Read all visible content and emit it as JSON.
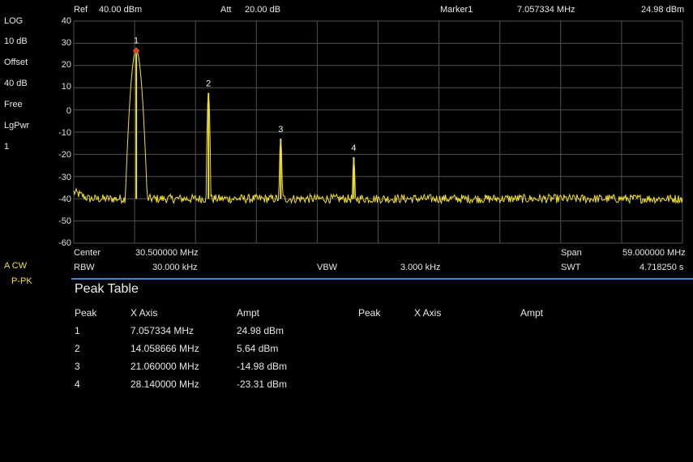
{
  "header": {
    "ref_label": "Ref",
    "ref_value": "40.00 dBm",
    "att_label": "Att",
    "att_value": "20.00 dB",
    "marker_label": "Marker1",
    "marker_freq": "7.057334 MHz",
    "marker_ampt": "24.98 dBm"
  },
  "sidebar": {
    "scale_mode": "LOG",
    "scale_div": "10 dB",
    "offset_label": "Offset",
    "offset_value": "40 dB",
    "trigger": "Free",
    "detector": "LgPwr",
    "avg_count": "1",
    "trace_mode": "A CW",
    "trace_detector": "P-PK"
  },
  "footer": {
    "center_label": "Center",
    "center_value": "30.500000 MHz",
    "span_label": "Span",
    "span_value": "59.000000 MHz",
    "rbw_label": "RBW",
    "rbw_value": "30.000 kHz",
    "vbw_label": "VBW",
    "vbw_value": "3.000 kHz",
    "swt_label": "SWT",
    "swt_value": "4.718250 s"
  },
  "peak_table": {
    "title": "Peak Table",
    "headers": [
      "Peak",
      "X Axis",
      "Ampt",
      "Peak",
      "X Axis",
      "Ampt"
    ],
    "rows": [
      {
        "peak": "1",
        "x": "7.057334 MHz",
        "ampt": "24.98 dBm"
      },
      {
        "peak": "2",
        "x": "14.058666 MHz",
        "ampt": "5.64 dBm"
      },
      {
        "peak": "3",
        "x": "21.060000 MHz",
        "ampt": "-14.98 dBm"
      },
      {
        "peak": "4",
        "x": "28.140000 MHz",
        "ampt": "-23.31 dBm"
      }
    ]
  },
  "colors": {
    "trace": "#f0e030",
    "marker": "#e04020",
    "grid": "#505050",
    "separator": "#3a86d0"
  },
  "chart_data": {
    "type": "line",
    "x_start_mhz": 1.0,
    "x_stop_mhz": 60.0,
    "ylim": [
      -60,
      40
    ],
    "yticks": [
      "40",
      "30",
      "20",
      "10",
      "0",
      "-10",
      "-20",
      "-30",
      "-40",
      "-50",
      "-60"
    ],
    "grid": true,
    "noise_floor_dbm": -40,
    "peaks": [
      {
        "label": "1",
        "freq_mhz": 7.057334,
        "ampt_dbm": 24.98
      },
      {
        "label": "2",
        "freq_mhz": 14.058666,
        "ampt_dbm": 5.64
      },
      {
        "label": "3",
        "freq_mhz": 21.06,
        "ampt_dbm": -14.98
      },
      {
        "label": "4",
        "freq_mhz": 28.14,
        "ampt_dbm": -23.31
      }
    ],
    "active_marker": "1"
  }
}
